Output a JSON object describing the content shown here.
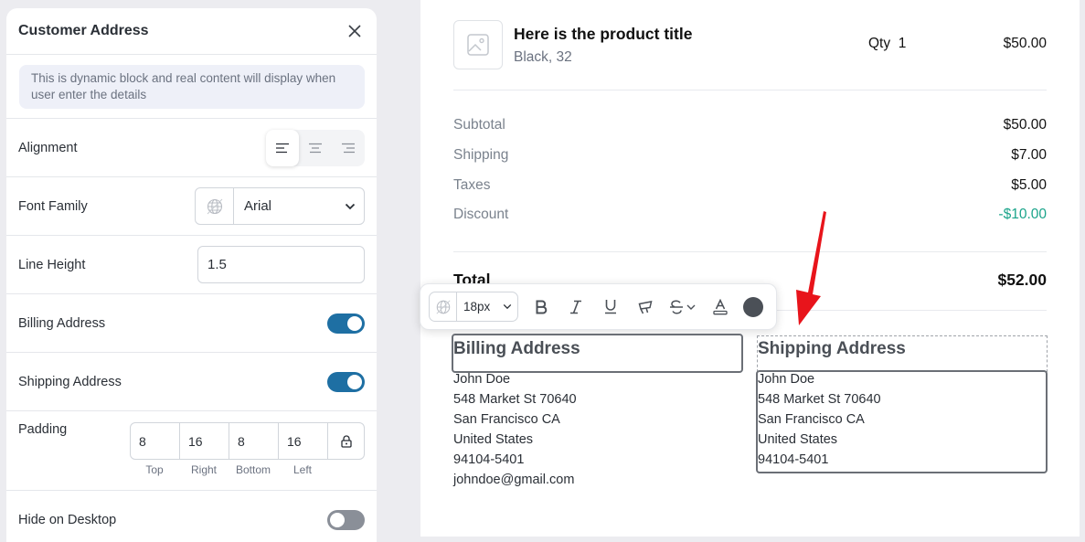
{
  "panel": {
    "title": "Customer Address",
    "notice": "This is dynamic block and real content will display when user enter the details",
    "alignment_label": "Alignment",
    "font_family_label": "Font Family",
    "font_family_value": "Arial",
    "line_height_label": "Line Height",
    "line_height_value": "1.5",
    "billing_label": "Billing Address",
    "billing_on": true,
    "shipping_label": "Shipping Address",
    "shipping_on": true,
    "padding_label": "Padding",
    "padding": {
      "top": "8",
      "right": "16",
      "bottom": "8",
      "left": "16",
      "top_label": "Top",
      "right_label": "Right",
      "bottom_label": "Bottom",
      "left_label": "Left"
    },
    "hide_desktop_label": "Hide on Desktop",
    "hide_desktop_on": false,
    "icons": {
      "close": "close-icon",
      "align_left": "align-left-icon",
      "align_center": "align-center-icon",
      "align_right": "align-right-icon",
      "globe": "globe-icon",
      "chevron": "chevron-down-icon",
      "lock": "lock-icon"
    },
    "accent_color": "#1e6fa3"
  },
  "order": {
    "product_title": "Here is the product title",
    "product_variant": "Black, 32",
    "qty_label": "Qty",
    "qty_value": "1",
    "price": "$50.00",
    "summary": [
      {
        "label": "Subtotal",
        "value": "$50.00"
      },
      {
        "label": "Shipping",
        "value": "$7.00"
      },
      {
        "label": "Taxes",
        "value": "$5.00"
      },
      {
        "label": "Discount",
        "value": "-$10.00"
      }
    ],
    "total_label": "Total",
    "total_value": "$52.00",
    "discount_color": "#1aa48a"
  },
  "toolbar": {
    "font_size": "18px",
    "icons": [
      "bold-icon",
      "italic-icon",
      "underline-icon",
      "highlight-icon",
      "strikethrough-icon",
      "text-color-icon"
    ],
    "color": "#4b5057"
  },
  "billing": {
    "title": "Billing Address",
    "lines": [
      "John Doe",
      "548 Market St 70640",
      "San Francisco CA",
      "United States",
      "94104-5401",
      "johndoe@gmail.com"
    ]
  },
  "shipping": {
    "title": "Shipping Address",
    "lines": [
      "John Doe",
      "548 Market St 70640",
      "San Francisco CA",
      "United States",
      "94104-5401"
    ]
  },
  "annotation": {
    "arrow_color": "#e8141b"
  }
}
